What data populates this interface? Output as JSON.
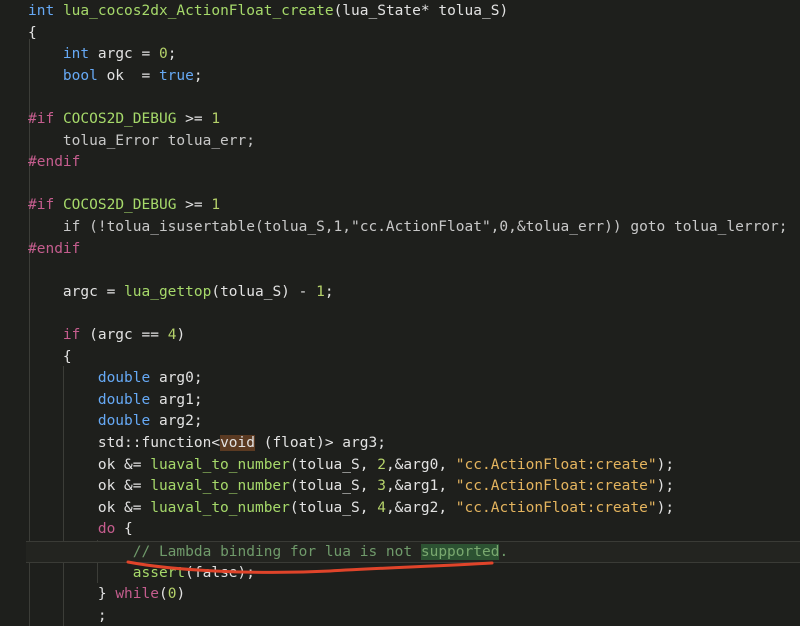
{
  "editor": {
    "lines": [
      [
        {
          "t": "int",
          "c": "kw"
        },
        {
          "t": " ",
          "c": "op"
        },
        {
          "t": "lua_cocos2dx_ActionFloat_create",
          "c": "fn"
        },
        {
          "t": "(lua_State",
          "c": "op"
        },
        {
          "t": "* ",
          "c": "op"
        },
        {
          "t": "tolua_S)",
          "c": "op"
        }
      ],
      [
        {
          "t": "{",
          "c": "op"
        }
      ],
      [
        {
          "t": "    ",
          "c": "op"
        },
        {
          "t": "int",
          "c": "kw"
        },
        {
          "t": " argc = ",
          "c": "op"
        },
        {
          "t": "0",
          "c": "num"
        },
        {
          "t": ";",
          "c": "op"
        }
      ],
      [
        {
          "t": "    ",
          "c": "op"
        },
        {
          "t": "bool",
          "c": "kw"
        },
        {
          "t": " ok  = ",
          "c": "op"
        },
        {
          "t": "true",
          "c": "kw"
        },
        {
          "t": ";",
          "c": "op"
        }
      ],
      [],
      [
        {
          "t": "#if",
          "c": "pp"
        },
        {
          "t": " ",
          "c": "op"
        },
        {
          "t": "COCOS2D_DEBUG",
          "c": "fn"
        },
        {
          "t": " >= ",
          "c": "op"
        },
        {
          "t": "1",
          "c": "num"
        }
      ],
      [
        {
          "t": "    tolua_Error tolua_err;",
          "c": "dim"
        }
      ],
      [
        {
          "t": "#endif",
          "c": "pp"
        }
      ],
      [],
      [
        {
          "t": "#if",
          "c": "pp"
        },
        {
          "t": " ",
          "c": "op"
        },
        {
          "t": "COCOS2D_DEBUG",
          "c": "fn"
        },
        {
          "t": " >= ",
          "c": "op"
        },
        {
          "t": "1",
          "c": "num"
        }
      ],
      [
        {
          "t": "    if (!tolua_isusertable(tolua_S,1,\"cc.ActionFloat\",0,&tolua_err)) goto tolua_lerror;",
          "c": "dim"
        }
      ],
      [
        {
          "t": "#endif",
          "c": "pp"
        }
      ],
      [],
      [
        {
          "t": "    argc = ",
          "c": "op"
        },
        {
          "t": "lua_gettop",
          "c": "fn"
        },
        {
          "t": "(tolua_S) ",
          "c": "op"
        },
        {
          "t": "- ",
          "c": "op"
        },
        {
          "t": "1",
          "c": "num"
        },
        {
          "t": ";",
          "c": "op"
        }
      ],
      [],
      [
        {
          "t": "    ",
          "c": "op"
        },
        {
          "t": "if",
          "c": "pp"
        },
        {
          "t": " (argc == ",
          "c": "op"
        },
        {
          "t": "4",
          "c": "num"
        },
        {
          "t": ")",
          "c": "op"
        }
      ],
      [
        {
          "t": "    {",
          "c": "op"
        }
      ],
      [
        {
          "t": "        ",
          "c": "op"
        },
        {
          "t": "double",
          "c": "kw"
        },
        {
          "t": " arg0;",
          "c": "op"
        }
      ],
      [
        {
          "t": "        ",
          "c": "op"
        },
        {
          "t": "double",
          "c": "kw"
        },
        {
          "t": " arg1;",
          "c": "op"
        }
      ],
      [
        {
          "t": "        ",
          "c": "op"
        },
        {
          "t": "double",
          "c": "kw"
        },
        {
          "t": " arg2;",
          "c": "op"
        }
      ],
      [
        {
          "t": "        std::function<",
          "c": "op"
        },
        {
          "t": "void",
          "c": "void"
        },
        {
          "t": " (float)> arg3;",
          "c": "op"
        }
      ],
      [
        {
          "t": "        ok &= ",
          "c": "op"
        },
        {
          "t": "luaval_to_number",
          "c": "fn"
        },
        {
          "t": "(tolua_S, ",
          "c": "op"
        },
        {
          "t": "2",
          "c": "num"
        },
        {
          "t": ",&arg0, ",
          "c": "op"
        },
        {
          "t": "\"cc.ActionFloat:create\"",
          "c": "str"
        },
        {
          "t": ");",
          "c": "op"
        }
      ],
      [
        {
          "t": "        ok &= ",
          "c": "op"
        },
        {
          "t": "luaval_to_number",
          "c": "fn"
        },
        {
          "t": "(tolua_S, ",
          "c": "op"
        },
        {
          "t": "3",
          "c": "num"
        },
        {
          "t": ",&arg1, ",
          "c": "op"
        },
        {
          "t": "\"cc.ActionFloat:create\"",
          "c": "str"
        },
        {
          "t": ");",
          "c": "op"
        }
      ],
      [
        {
          "t": "        ok &= ",
          "c": "op"
        },
        {
          "t": "luaval_to_number",
          "c": "fn"
        },
        {
          "t": "(tolua_S, ",
          "c": "op"
        },
        {
          "t": "4",
          "c": "num"
        },
        {
          "t": ",&arg2, ",
          "c": "op"
        },
        {
          "t": "\"cc.ActionFloat:create\"",
          "c": "str"
        },
        {
          "t": ");",
          "c": "op"
        }
      ],
      [
        {
          "t": "        ",
          "c": "op"
        },
        {
          "t": "do",
          "c": "pp"
        },
        {
          "t": " {",
          "c": "op"
        }
      ],
      [
        {
          "t": "            ",
          "c": "op"
        },
        {
          "t": "// Lambda binding for lua is not ",
          "c": "cmt"
        },
        {
          "t": "supported",
          "c": "hl"
        },
        {
          "t": ".",
          "c": "cmt"
        }
      ],
      [
        {
          "t": "            ",
          "c": "op"
        },
        {
          "t": "assert",
          "c": "fn"
        },
        {
          "t": "(false);",
          "c": "op"
        }
      ],
      [
        {
          "t": "        } ",
          "c": "op"
        },
        {
          "t": "while",
          "c": "pp"
        },
        {
          "t": "(",
          "c": "op"
        },
        {
          "t": "0",
          "c": "num"
        },
        {
          "t": ")",
          "c": "op"
        }
      ],
      [
        {
          "t": "        ;",
          "c": "op"
        }
      ]
    ],
    "current_line_index": 25
  }
}
